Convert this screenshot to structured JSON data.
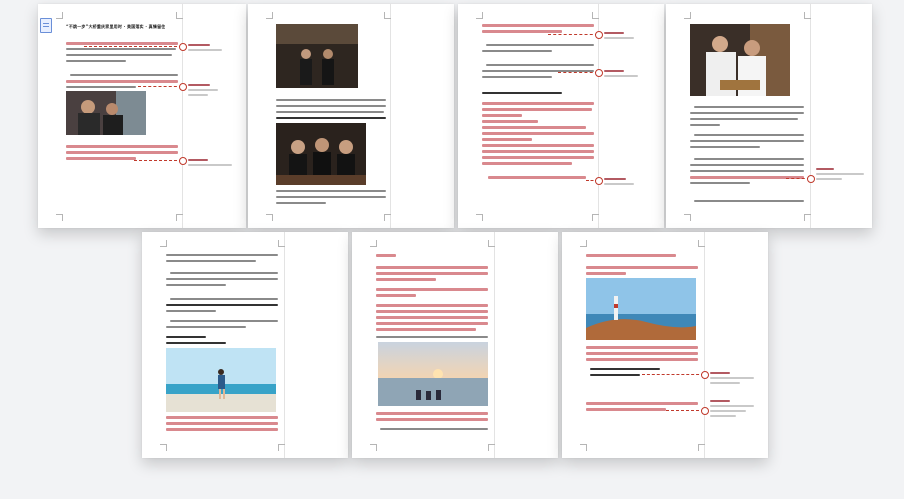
{
  "document": {
    "title": "“不跳一步”大桥重庆家里用时 · 美国落实 · 真情留住",
    "pages": [
      {
        "index": 1,
        "section": "page-1"
      },
      {
        "index": 2,
        "section": "page-2"
      },
      {
        "index": 3,
        "section": "page-3"
      },
      {
        "index": 4,
        "section": "page-4"
      },
      {
        "index": 5,
        "section": "page-5"
      },
      {
        "index": 6,
        "section": "page-6"
      },
      {
        "index": 7,
        "section": "page-7"
      }
    ],
    "colors": {
      "highlight": "#d9898e",
      "comment": "#c0392b",
      "page": "#ffffff",
      "background": "#f2f3f5"
    },
    "icons": [
      "document-icon",
      "comment-pin-icon"
    ]
  }
}
